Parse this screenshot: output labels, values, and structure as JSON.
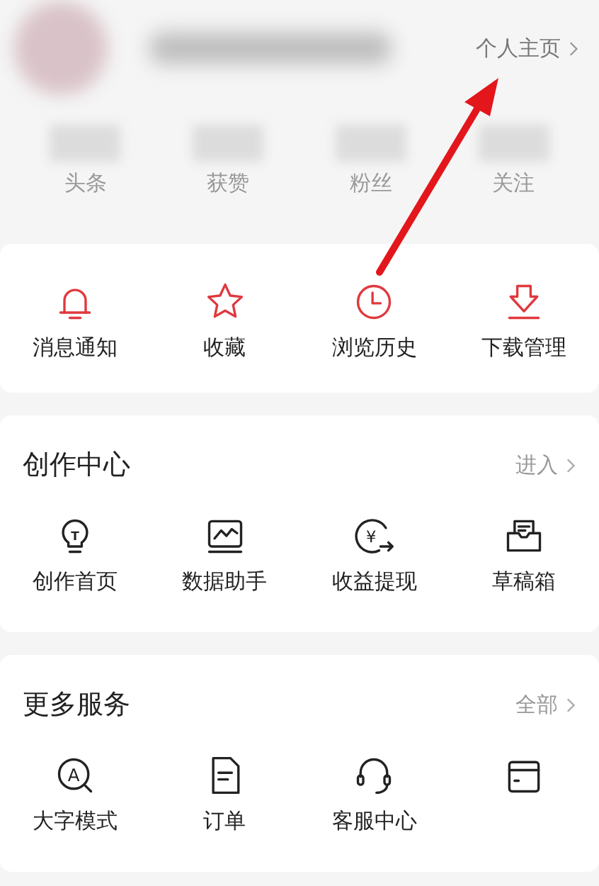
{
  "profile": {
    "homepage_link": "个人主页",
    "stats": [
      {
        "label": "头条"
      },
      {
        "label": "获赞"
      },
      {
        "label": "粉丝"
      },
      {
        "label": "关注"
      }
    ]
  },
  "quick_actions": [
    {
      "kind": "bell",
      "label": "消息通知"
    },
    {
      "kind": "star",
      "label": "收藏"
    },
    {
      "kind": "clock",
      "label": "浏览历史"
    },
    {
      "kind": "download",
      "label": "下载管理"
    }
  ],
  "sections": [
    {
      "title": "创作中心",
      "link": "进入",
      "items": [
        {
          "kind": "bulb",
          "glyph": "T",
          "label": "创作首页"
        },
        {
          "kind": "chart",
          "label": "数据助手"
        },
        {
          "kind": "withdraw",
          "glyph": "¥",
          "label": "收益提现"
        },
        {
          "kind": "drafts",
          "label": "草稿箱"
        }
      ]
    },
    {
      "title": "更多服务",
      "link": "全部",
      "items": [
        {
          "kind": "zoom",
          "glyph": "A",
          "label": "大字模式"
        },
        {
          "kind": "doc",
          "label": "订单"
        },
        {
          "kind": "headset",
          "label": "客服中心"
        },
        {
          "kind": "wallet"
        }
      ]
    }
  ],
  "annotation": {
    "kind": "arrow"
  }
}
